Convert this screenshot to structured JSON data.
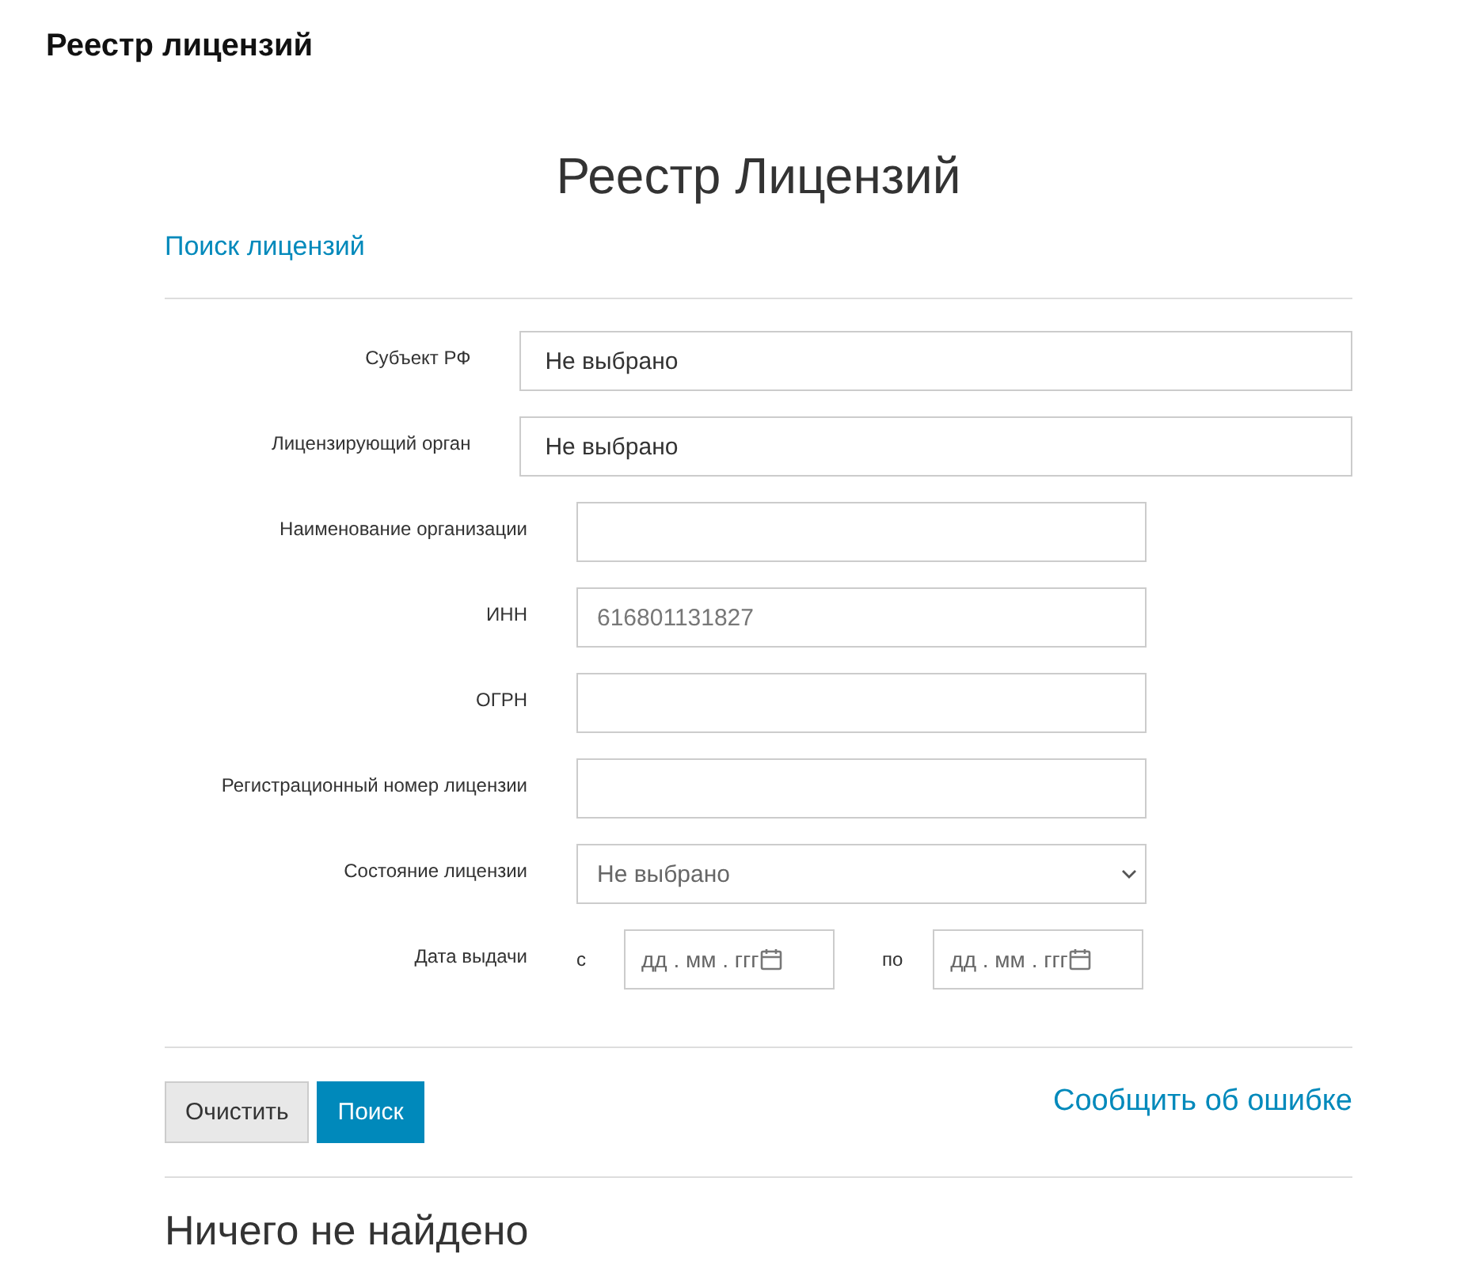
{
  "page_title": "Реестр лицензий",
  "heading": "Реестр Лицензий",
  "section_link": "Поиск лицензий",
  "fields": [
    {
      "kind": "select_wide",
      "label": "Субъект РФ",
      "value": "Не выбрано"
    },
    {
      "kind": "select_wide",
      "label": "Лицензирующий орган",
      "value": "Не выбрано"
    },
    {
      "kind": "text",
      "label": "Наименование организации"
    },
    {
      "kind": "text",
      "label": "ИНН",
      "placeholder": "616801131827"
    },
    {
      "kind": "text",
      "label": "ОГРН"
    },
    {
      "kind": "text",
      "label": "Регистрационный номер лицензии"
    },
    {
      "kind": "select",
      "label": "Состояние лицензии",
      "value": "Не выбрано"
    },
    {
      "kind": "date_range",
      "label": "Дата выдачи",
      "from_label": "с",
      "from_placeholder": "дд . мм . ггг",
      "to_label": "по",
      "to_placeholder": "дд . мм . ггг"
    }
  ],
  "buttons": [
    {
      "kind": "secondary",
      "label": "Очистить"
    },
    {
      "kind": "primary",
      "label": "Поиск"
    }
  ],
  "report_link": "Сообщить об ошибке",
  "result": "Ничего не найдено"
}
